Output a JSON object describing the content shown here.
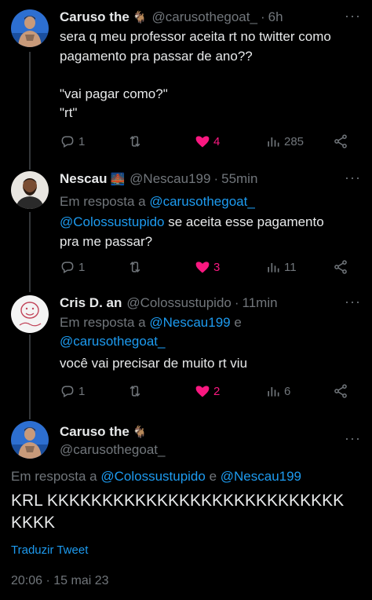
{
  "tweets": [
    {
      "name": "Caruso the",
      "emoji": "🐐",
      "handle": "@carusothegoat_",
      "time": "6h",
      "lines": [
        "sera q meu professor aceita rt no twitter como",
        "pagamento pra passar de ano??",
        "\"vai pagar como?\"",
        "\"rt\""
      ],
      "replies": "1",
      "retweets": "",
      "likes": "4",
      "views": "285"
    },
    {
      "name": "Nescau",
      "emoji": "🌉",
      "handle": "@Nescau199",
      "time": "55min",
      "reply_prefix": "Em resposta a",
      "reply_to": "@carusothegoat_",
      "mention": "@Colossustupido",
      "line1_rest": " se aceita esse pagamento",
      "line2": "pra me passar?",
      "replies": "1",
      "likes": "3",
      "views": "11"
    },
    {
      "name": "Cris D. an",
      "handle": "@Colossustupido",
      "time": "11min",
      "reply_prefix": "Em resposta a",
      "reply_to_1": "@Nescau199",
      "reply_joiner": " e",
      "reply_to_2": "@carusothegoat_",
      "text": "você vai precisar de muito rt viu",
      "replies": "1",
      "likes": "2",
      "views": "6"
    },
    {
      "name": "Caruso the",
      "emoji": "🐐",
      "handle": "@carusothegoat_",
      "reply_prefix": "Em resposta a",
      "reply_to_1": "@Colossustupido",
      "reply_joiner": " e ",
      "reply_to_2": "@Nescau199",
      "text_line1": "KRL KKKKKKKKKKKKKKKKKKKKKKKKKKK",
      "text_line2": "KKKK",
      "translate": "Traduzir Tweet",
      "timestamp": "20:06 · 15 mai 23"
    }
  ],
  "colors": {
    "accent": "#1d9bf0",
    "like": "#f91880",
    "muted": "#71767b",
    "text": "#e7e9ea"
  }
}
